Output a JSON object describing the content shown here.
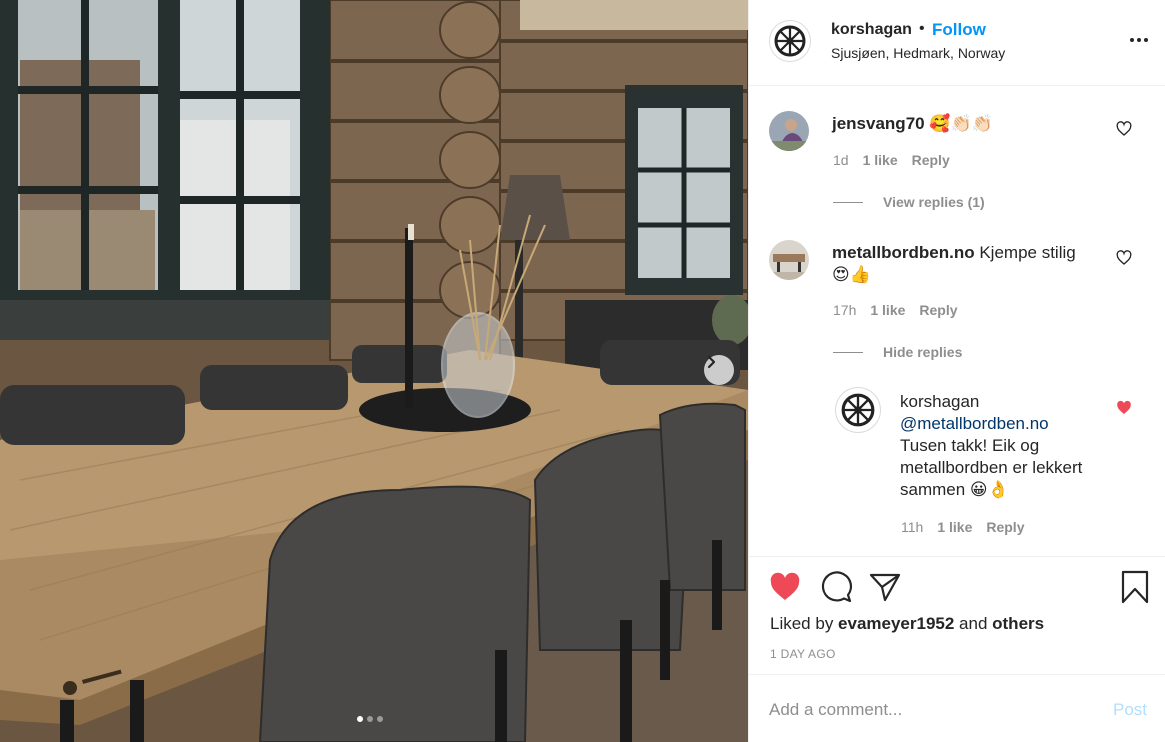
{
  "post": {
    "username": "korshagan",
    "separator": "•",
    "follow_label": "Follow",
    "location": "Sjusjøen, Hedmark, Norway",
    "more_icon": "more-options-icon",
    "carousel": {
      "slides": 3,
      "active_slide": 1,
      "next_icon": "chevron-right-icon"
    }
  },
  "comments": [
    {
      "username": "jensvang70",
      "text": " 🥰👏🏻👏🏻",
      "age": "1d",
      "likes": "1 like",
      "reply_label": "Reply",
      "view_replies": "View replies (1)"
    },
    {
      "username": "metallbordben.no",
      "text_line1": " Kjempe stilig",
      "text_line2": "😍👍",
      "age": "17h",
      "likes": "1 like",
      "reply_label": "Reply",
      "hide_replies": "Hide replies",
      "reply": {
        "username": "korshagan",
        "mention": "@metallbordben.no",
        "text_lines": [
          "Tusen takk! Eik og",
          "metallbordben er lekkert",
          "sammen 😀👌"
        ],
        "age": "11h",
        "likes": "1 like",
        "reply_label": "Reply",
        "liked": true
      }
    }
  ],
  "actions": {
    "liked": true,
    "liked_by_prefix": "Liked by ",
    "liked_by_user": "evameyer1952",
    "liked_by_and": " and ",
    "liked_by_others": "others",
    "time_ago": "1 DAY AGO"
  },
  "comment_box": {
    "placeholder": "Add a comment...",
    "post_label": "Post"
  },
  "colors": {
    "accent": "#0095f6",
    "heart": "#ed4956",
    "post_disabled": "#b2dffc",
    "muted": "#8e8e8e"
  }
}
